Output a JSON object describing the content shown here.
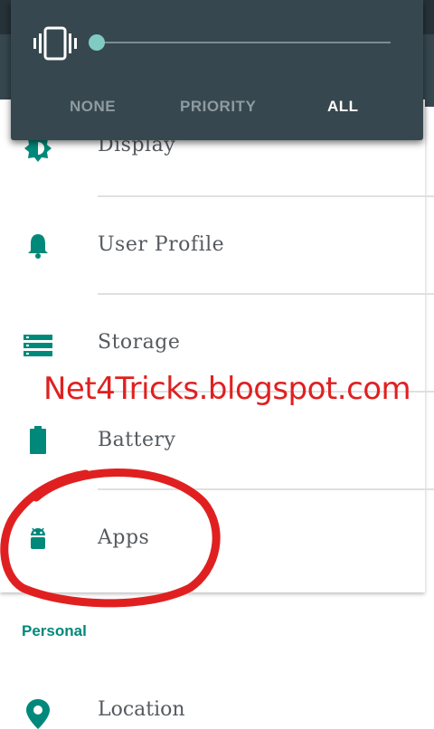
{
  "settings": {
    "items": [
      {
        "label": "Display",
        "icon": "brightness-icon"
      },
      {
        "label": "User Profile",
        "icon": "bell-icon"
      },
      {
        "label": "Storage",
        "icon": "storage-icon"
      },
      {
        "label": "Battery",
        "icon": "battery-icon"
      },
      {
        "label": "Apps",
        "icon": "android-icon"
      }
    ],
    "section_header": "Personal",
    "location_label": "Location"
  },
  "volume_panel": {
    "modes": [
      "NONE",
      "PRIORITY",
      "ALL"
    ],
    "selected_mode": "ALL",
    "slider_level": 0
  },
  "watermark": "Net4Tricks.blogspot.com",
  "colors": {
    "accent": "#00897b",
    "panel_bg": "#37474f",
    "thumb": "#80cbc4",
    "annotation": "#e02020"
  }
}
